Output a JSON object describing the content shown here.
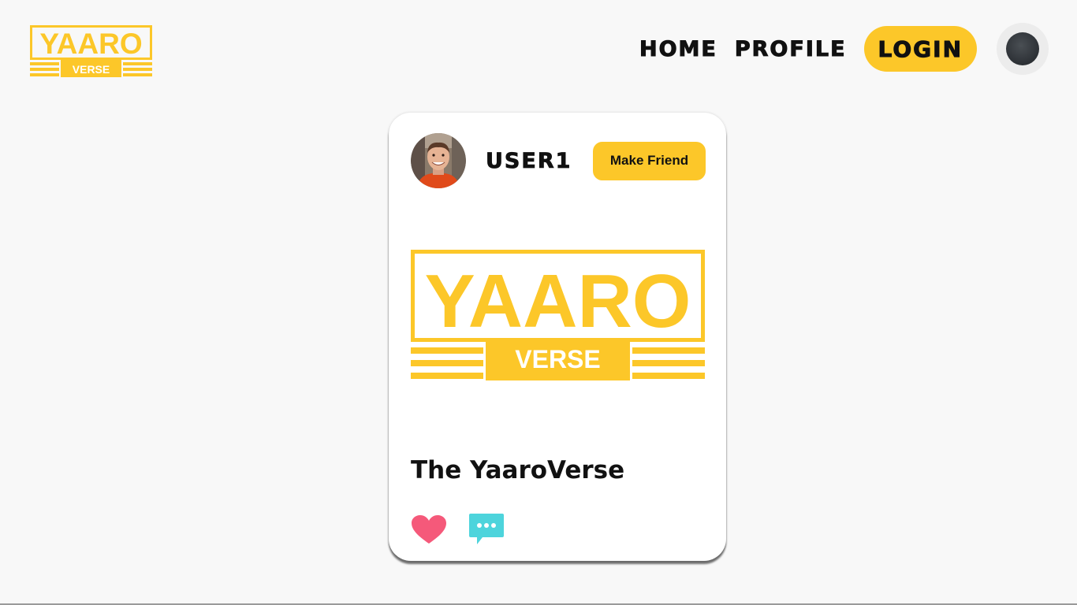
{
  "brand": {
    "logo_word": "YAARO",
    "logo_sub": "VERSE",
    "accent": "#fcc729"
  },
  "nav": {
    "home": "HOME",
    "profile": "PROFILE",
    "login": "LOGIN"
  },
  "post": {
    "username": "USER1",
    "make_friend": "Make Friend",
    "image_word": "YAARO",
    "image_sub": "VERSE",
    "title": "The YaaroVerse",
    "like_color": "#f5597a",
    "comment_color": "#4dd4dc"
  }
}
